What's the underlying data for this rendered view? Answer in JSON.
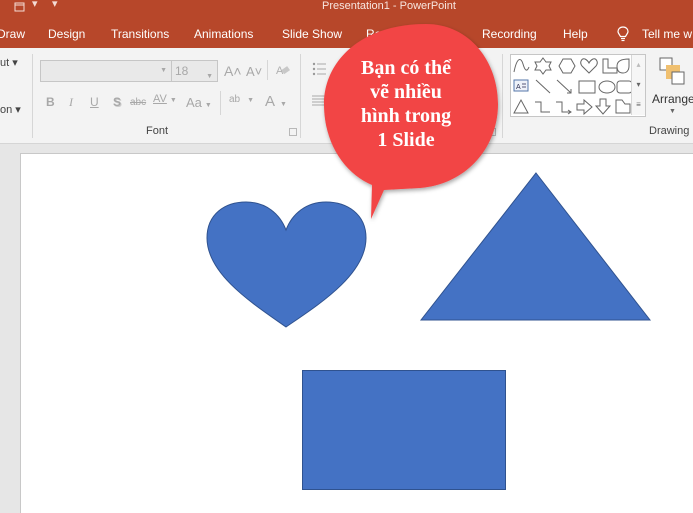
{
  "window": {
    "title": "Presentation1  -  PowerPoint"
  },
  "quick_access": {
    "icons": [
      "presentation-icon",
      "customize-dropdown-icon"
    ]
  },
  "tabs": [
    {
      "label": "Draw"
    },
    {
      "label": "Design"
    },
    {
      "label": "Transitions"
    },
    {
      "label": "Animations"
    },
    {
      "label": "Slide Show"
    },
    {
      "label": "Review"
    },
    {
      "label": "Recording"
    },
    {
      "label": "Help"
    }
  ],
  "tell_me": {
    "label": "Tell me w",
    "icon": "lightbulb-icon"
  },
  "ribbon": {
    "left_fragments": [
      "ut ▾",
      "on ▾"
    ],
    "font_group": {
      "label": "Font",
      "font_name": "",
      "font_size": "18",
      "buttons": {
        "increase_size": "A˄",
        "decrease_size": "A˅",
        "clear_format": "A⁄",
        "bold": "B",
        "italic": "I",
        "underline": "U",
        "shadow": "S",
        "strikethrough": "abc",
        "char_spacing": "AV",
        "change_case": "Aa",
        "highlight": "ab",
        "font_color": "A"
      }
    },
    "paragraph_group": {
      "icons": [
        "bullets-icon",
        "align-icon"
      ]
    },
    "drawing_group": {
      "label": "Drawing",
      "shapes": [
        "curve",
        "star-6",
        "hexagon",
        "heart",
        "l-shape",
        "teardrop",
        "text-box",
        "line",
        "arrow-line",
        "rectangle",
        "oval",
        "rounded-rectangle",
        "triangle",
        "elbow-connector",
        "elbow-arrow-connector",
        "right-arrow",
        "down-arrow",
        "folded-shape"
      ],
      "arrange_label": "Arrange"
    }
  },
  "slide": {
    "callout": {
      "text_lines": [
        "Bạn có thể",
        "vẽ nhiều",
        "hình trong",
        "1 Slide"
      ],
      "color": "#f24444"
    },
    "shapes": [
      {
        "type": "heart",
        "color": "#4472c4"
      },
      {
        "type": "triangle",
        "color": "#4472c4"
      },
      {
        "type": "rectangle",
        "color": "#4472c4"
      }
    ]
  },
  "colors": {
    "accent": "#b7472a",
    "shape_fill": "#4472c4",
    "shape_outline": "#2f528f",
    "callout_fill": "#f24444"
  }
}
